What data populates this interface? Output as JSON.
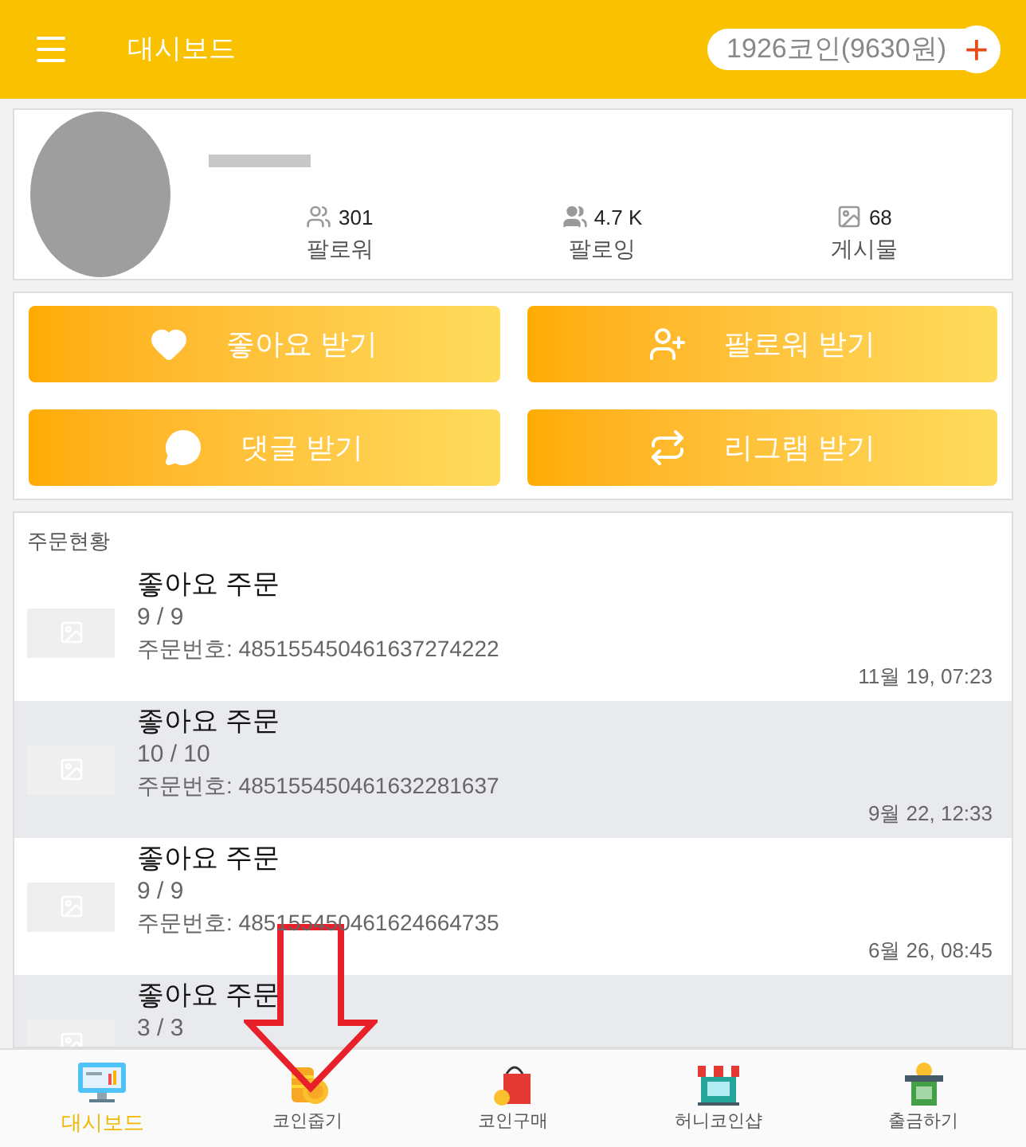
{
  "header": {
    "title": "대시보드",
    "coins": "1926코인(9630원)",
    "add": "+"
  },
  "profile": {
    "stats": [
      {
        "kind": "followers",
        "value": "301",
        "label": "팔로워"
      },
      {
        "kind": "following",
        "value": "4.7 K",
        "label": "팔로잉"
      },
      {
        "kind": "posts",
        "value": "68",
        "label": "게시물"
      }
    ]
  },
  "actions": [
    {
      "kind": "like",
      "label": "좋아요 받기"
    },
    {
      "kind": "follower",
      "label": "팔로워 받기"
    },
    {
      "kind": "comment",
      "label": "댓글 받기"
    },
    {
      "kind": "regram",
      "label": "리그램 받기"
    }
  ],
  "orders": {
    "title": "주문현황",
    "rows": [
      {
        "title": "좋아요 주문",
        "count": "9 / 9",
        "order_no": "주문번호: 485155450461637274222",
        "date": "11월 19, 07:23"
      },
      {
        "title": "좋아요 주문",
        "count": "10 / 10",
        "order_no": "주문번호: 485155450461632281637",
        "date": "9월 22, 12:33"
      },
      {
        "title": "좋아요 주문",
        "count": "9 / 9",
        "order_no": "주문번호: 485155450461624664735",
        "date": "6월 26, 08:45"
      },
      {
        "title": "좋아요 주문",
        "count": "3 / 3"
      }
    ]
  },
  "nav": [
    {
      "kind": "dashboard",
      "label": "대시보드",
      "selected": true
    },
    {
      "kind": "coins",
      "label": "코인줍기",
      "selected": false
    },
    {
      "kind": "buy",
      "label": "코인구매",
      "selected": false
    },
    {
      "kind": "shop",
      "label": "허니코인샵",
      "selected": false
    },
    {
      "kind": "withdraw",
      "label": "출금하기",
      "selected": false
    }
  ]
}
